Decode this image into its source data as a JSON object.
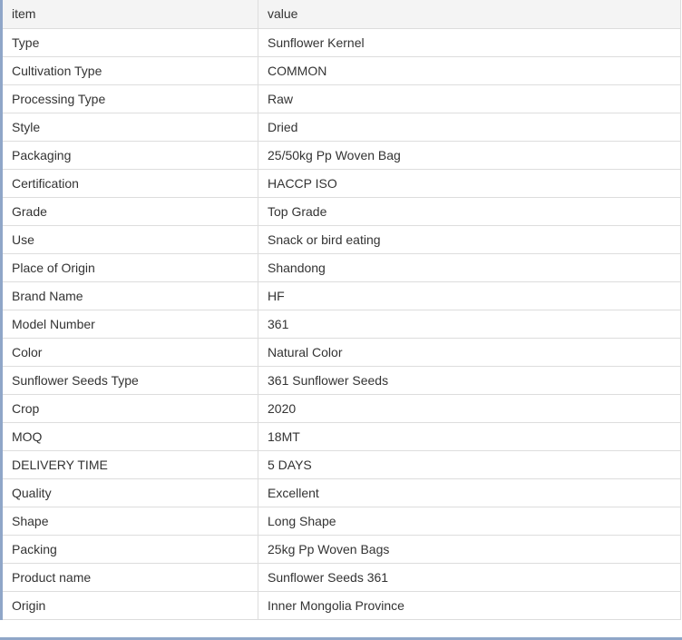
{
  "table": {
    "header": {
      "item": "item",
      "value": "value"
    },
    "rows": [
      {
        "item": "Type",
        "value": "Sunflower Kernel"
      },
      {
        "item": "Cultivation Type",
        "value": "COMMON"
      },
      {
        "item": "Processing Type",
        "value": "Raw"
      },
      {
        "item": "Style",
        "value": "Dried"
      },
      {
        "item": "Packaging",
        "value": "25/50kg Pp Woven Bag"
      },
      {
        "item": "Certification",
        "value": "HACCP ISO"
      },
      {
        "item": "Grade",
        "value": "Top Grade"
      },
      {
        "item": "Use",
        "value": "Snack or bird eating"
      },
      {
        "item": "Place of Origin",
        "value": "Shandong"
      },
      {
        "item": "Brand Name",
        "value": "HF"
      },
      {
        "item": "Model Number",
        "value": "361"
      },
      {
        "item": "Color",
        "value": "Natural Color"
      },
      {
        "item": "Sunflower Seeds Type",
        "value": "361 Sunflower Seeds"
      },
      {
        "item": "Crop",
        "value": "2020"
      },
      {
        "item": "MOQ",
        "value": "18MT"
      },
      {
        "item": "DELIVERY TIME",
        "value": "5 DAYS"
      },
      {
        "item": "Quality",
        "value": "Excellent"
      },
      {
        "item": "Shape",
        "value": "Long Shape"
      },
      {
        "item": "Packing",
        "value": "25kg Pp Woven Bags"
      },
      {
        "item": "Product name",
        "value": "Sunflower Seeds 361"
      },
      {
        "item": "Origin",
        "value": "Inner Mongolia Province"
      }
    ]
  },
  "colors": {
    "accent_border": "#8fa6c8",
    "header_bg": "#f4f4f4",
    "grid_line": "#dddddd",
    "text": "#333333"
  }
}
